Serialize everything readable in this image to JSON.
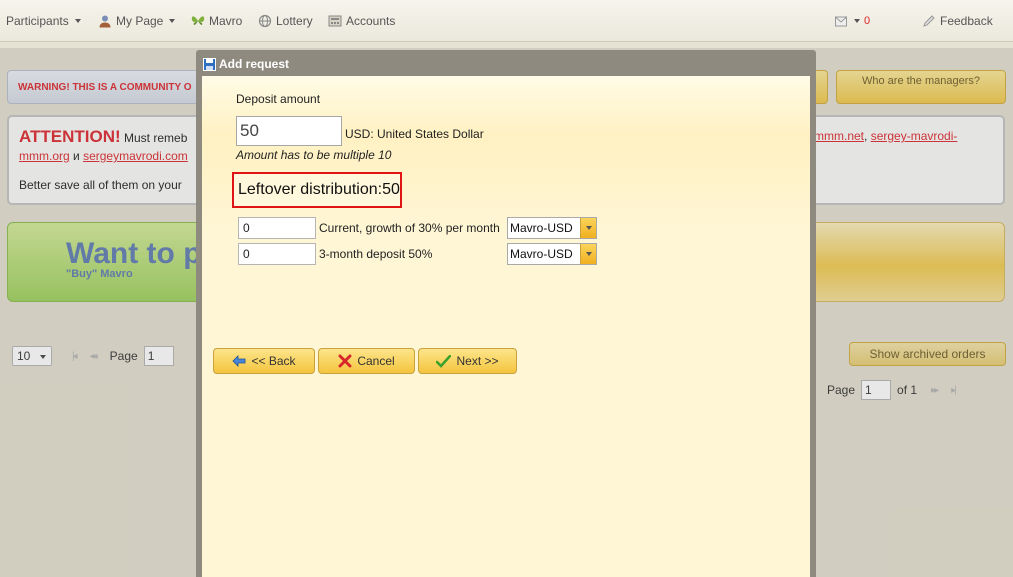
{
  "nav": {
    "participants": "Participants",
    "my_page": "My Page",
    "mavro": "Mavro",
    "lottery": "Lottery",
    "accounts": "Accounts",
    "notifications_count": "0",
    "feedback": "Feedback"
  },
  "background": {
    "warning": "WARNING! THIS IS A COMMUNITY O",
    "who_managers": "Who are the managers?",
    "attention_title": "ATTENTION!",
    "attention_text": "Must remeb",
    "link_mmm_org_1": "mmm.org",
    "and_word": "и",
    "link_sergey_1": "sergeymavrodi.com",
    "better_save": "Better save all of them on your",
    "link_mmm_net": "mmm.net",
    "link_sergey_2": "sergey-mavrodi-",
    "want_title": "Want to p",
    "want_sub": "\"Buy\" Mavro",
    "page_size": "10",
    "page_label": "Page",
    "page_value": "1",
    "show_archived": "Show archived orders",
    "page_label_2": "Page",
    "page_value_2": "1",
    "of_label": "of 1"
  },
  "modal": {
    "title": "Add request",
    "deposit_label": "Deposit amount",
    "deposit_value": "50",
    "currency": "USD: United States Dollar",
    "hint": "Amount has to be multiple 10",
    "leftover_label": "Leftover distribution:",
    "leftover_value": "50",
    "rows": [
      {
        "value": "0",
        "label": "Current, growth of 30% per month",
        "currency": "Mavro-USD"
      },
      {
        "value": "0",
        "label": "3-month deposit 50%",
        "currency": "Mavro-USD"
      }
    ],
    "back_button": "<< Back",
    "cancel_button": "Cancel",
    "next_button": "Next >>"
  },
  "colors": {
    "accent_red": "#e0393e",
    "button_yellow": "#f4c43e",
    "modal_frame": "#8f8a80"
  }
}
